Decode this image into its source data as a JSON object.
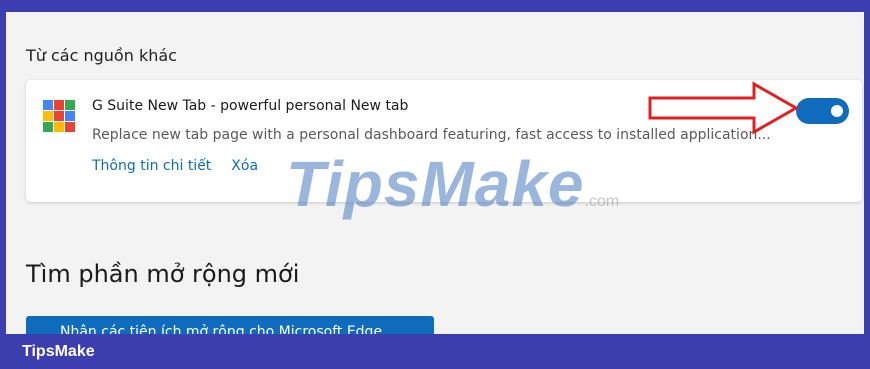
{
  "section": {
    "other_sources_label": "Từ các nguồn khác"
  },
  "extension": {
    "title": "G Suite New Tab - powerful personal New tab",
    "description": "Replace new tab page with a personal dashboard featuring, fast access to installed application...",
    "details_link": "Thông tin chi tiết",
    "remove_link": "Xóa",
    "enabled": true,
    "icon": "g-suite-grid-icon"
  },
  "find_new": {
    "heading": "Tìm phần mở rộng mới",
    "button_label": "Nhận các tiện ích mở rộng cho Microsoft Edge"
  },
  "watermark": {
    "brand": "TipsMake",
    "suffix": ".com"
  },
  "footer": {
    "brand": "TipsMake"
  },
  "colors": {
    "accent": "#0f6cbd",
    "frame_border": "#3d3fb0",
    "annotation_arrow": "#e02020"
  }
}
